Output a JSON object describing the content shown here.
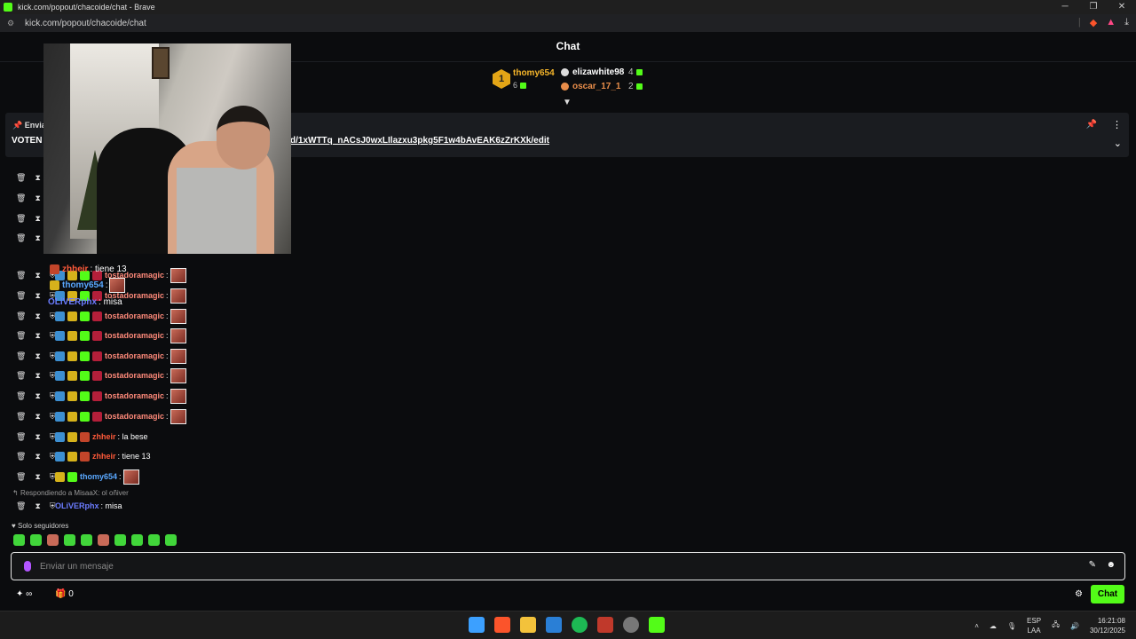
{
  "window": {
    "title": "kick.com/popout/chacoide/chat - Brave",
    "url": "kick.com/popout/chacoide/chat",
    "min": "─",
    "restore": "❐",
    "close": "✕"
  },
  "chat": {
    "header": "Chat",
    "leaderboard": [
      {
        "rank": "1",
        "name": "thomy654",
        "count": "6"
      },
      {
        "name": "elizawhite98",
        "count": "4"
      },
      {
        "name": "oscar_17_1",
        "count": "2"
      }
    ],
    "pinned": {
      "label": "Enviad",
      "text": "VOTEN",
      "link": "d/1xWTTq_nACsJ0wxLIlazxu3pkg5F1w4bAvEAK6zZrKXk/edit"
    },
    "messages": [
      {
        "user": "tostadoramagic",
        "text": "",
        "color": "#ff8a7a"
      },
      {
        "user": "tostadoramagic",
        "text": "",
        "color": "#ff8a7a"
      },
      {
        "user": "tostadoramagic",
        "text": "",
        "color": "#ff8a7a"
      },
      {
        "user": "tostadoramagic",
        "text": "",
        "color": "#ff8a7a"
      },
      {
        "user": "tostadoramagic",
        "text": "",
        "color": "#ff8a7a"
      },
      {
        "user": "tostadoramagic",
        "text": "",
        "color": "#ff8a7a"
      },
      {
        "user": "tostadoramagic",
        "text": "",
        "color": "#ff8a7a"
      },
      {
        "user": "tostadoramagic",
        "text": "",
        "color": "#ff8a7a"
      },
      {
        "user": "zhheir",
        "text": "la bese",
        "color": "#ff5a3a"
      },
      {
        "user": "zhheir",
        "text": "tiene 13",
        "color": "#ff5a3a"
      },
      {
        "user": "thomy654",
        "text": "",
        "color": "#5aa8ff"
      }
    ],
    "overlay_messages": [
      {
        "user": "zhheir",
        "text": "tiene 13"
      },
      {
        "user": "thomy654",
        "text": ""
      },
      {
        "user": "OLiVERphx",
        "text": "misa"
      }
    ],
    "reply_to": "Respondiendo a MisaaX: ol oñiver",
    "last_message": {
      "user": "OLiVERphx",
      "text": "misa"
    },
    "followers_only": "Solo seguidores",
    "input_placeholder": "Enviar un mensaje",
    "points": "∞",
    "gifts": "0",
    "send_button": "Chat"
  },
  "taskbar": {
    "lang": "ESP",
    "lang2": "LAA",
    "time": "16:21:08",
    "date": "30/12/2025"
  },
  "colors": {
    "accent": "#53fc18"
  }
}
